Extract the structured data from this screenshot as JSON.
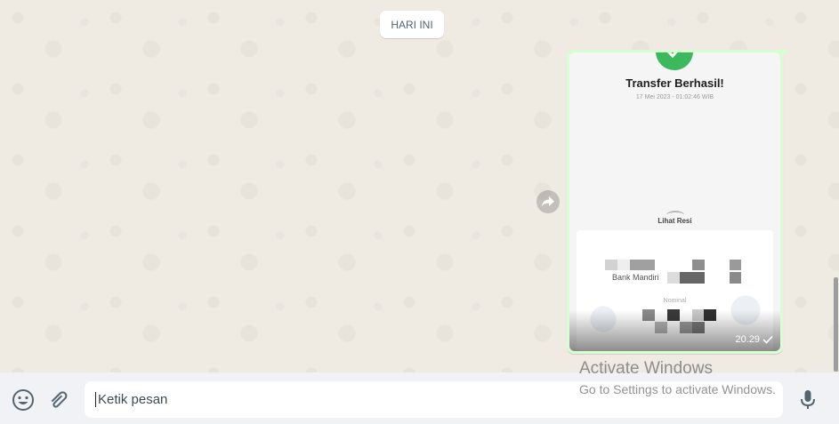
{
  "chat": {
    "date_chip": "HARI INI",
    "message": {
      "receipt_title": "Transfer Berhasil!",
      "receipt_date": "17 Mei 2023 - 01:02:46 WIB",
      "lihat_resi": "Lihat Resi",
      "bank_name": "Bank Mandiri",
      "nominal_label": "Nominal",
      "time": "20.29",
      "status_icon": "single-check-icon"
    }
  },
  "composer": {
    "placeholder": "Ketik pesan",
    "emoji_icon": "emoji-icon",
    "attach_icon": "paperclip-icon",
    "mic_icon": "microphone-icon"
  },
  "watermark": {
    "title": "Activate Windows",
    "subtitle": "Go to Settings to activate Windows."
  },
  "colors": {
    "chat_background": "#efeae2",
    "outgoing_bubble": "#d9fdd3",
    "success_green": "#3cb95c",
    "footer_background": "#f0f2f5",
    "icon_color": "#54656f"
  }
}
